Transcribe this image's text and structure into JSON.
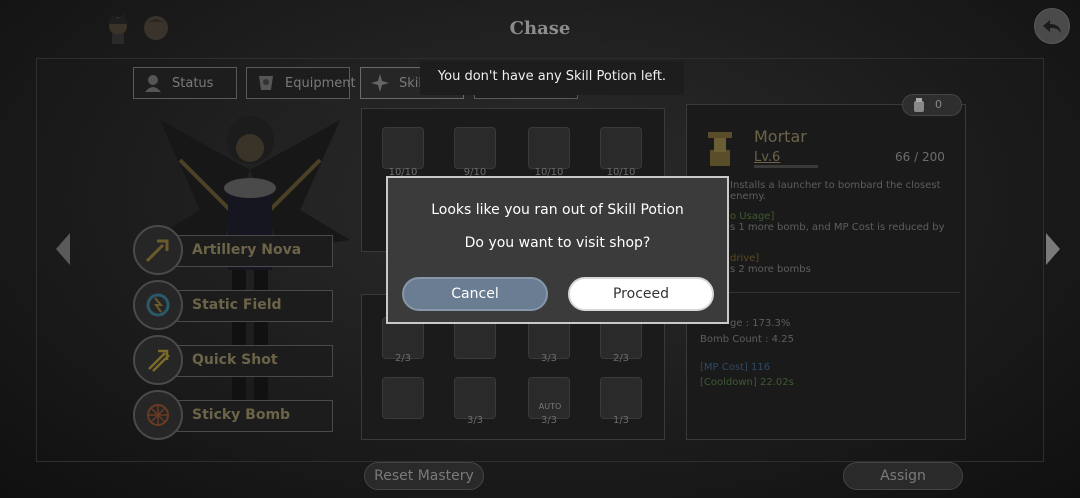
{
  "header": {
    "title": "Chase",
    "portraits": [
      "character-portrait-icon",
      "companion-portrait-icon"
    ],
    "back_icon": "back-arrow-icon"
  },
  "tabs": [
    {
      "label": "Status",
      "icon": "character-icon"
    },
    {
      "label": "Equipment",
      "icon": "equipment-icon"
    },
    {
      "label": "Skill",
      "icon": "skill-icon"
    },
    {
      "label": "",
      "icon": "other-tab-icon"
    }
  ],
  "equipped_skills": [
    {
      "label": "Artillery Nova",
      "icon": "artillery-nova-icon"
    },
    {
      "label": "Static Field",
      "icon": "static-field-icon"
    },
    {
      "label": "Quick Shot",
      "icon": "quick-shot-icon"
    },
    {
      "label": "Sticky Bomb",
      "icon": "sticky-bomb-icon"
    }
  ],
  "grid": {
    "top_row_counts": [
      "10/10",
      "9/10",
      "10/10",
      "10/10"
    ],
    "bottom_row1_counts": [
      "2/3",
      "",
      "3/3",
      "2/3"
    ],
    "bottom_row2_counts": [
      "",
      "3/3",
      "3/3",
      "1/3"
    ],
    "auto_label": "AUTO"
  },
  "details": {
    "potion_count": "0",
    "skill_name": "Mortar",
    "level": "Lv.6",
    "exp": "66 / 200",
    "description": "Installs a launcher to bombard the closest enemy.",
    "line_a_header": "o Usage]",
    "line_a_text": "s 1 more bomb, and MP Cost is reduced by",
    "line_b_header": "drive]",
    "line_b_text": "s 2 more bombs",
    "stat_damage": "ge : 173.3%",
    "stat_bomb_count": "Bomb Count : 4.25",
    "stat_mp_cost": "[MP Cost] 116",
    "stat_cooldown": "[Cooldown] 22.02s"
  },
  "bottom": {
    "reset_label": "Reset Mastery",
    "assign_label": "Assign"
  },
  "toast": {
    "text": "You don't have any Skill Potion left."
  },
  "modal": {
    "message1": "Looks like you ran out of Skill Potion",
    "message2": "Do you want to visit shop?",
    "cancel_label": "Cancel",
    "proceed_label": "Proceed"
  },
  "colors": {
    "cancel_button": "#6a7d93",
    "proceed_button": "#ffffff",
    "modal_bg": "#3b3b3b",
    "skill_gold": "#6b6448"
  }
}
